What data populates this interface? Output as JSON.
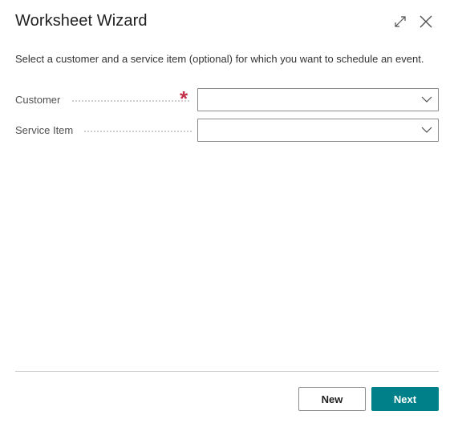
{
  "dialog": {
    "title": "Worksheet Wizard",
    "expand_icon": "expand-icon",
    "close_icon": "close-icon",
    "instructions": "Select a customer and a service item (optional) for which you want to schedule an event."
  },
  "fields": {
    "customer": {
      "label": "Customer",
      "value": "",
      "required": true,
      "required_marker": "*"
    },
    "service_item": {
      "label": "Service Item",
      "value": ""
    }
  },
  "buttons": {
    "new_label": "New",
    "next_label": "Next"
  },
  "colors": {
    "accent": "#00818a",
    "required": "#c4314b"
  }
}
